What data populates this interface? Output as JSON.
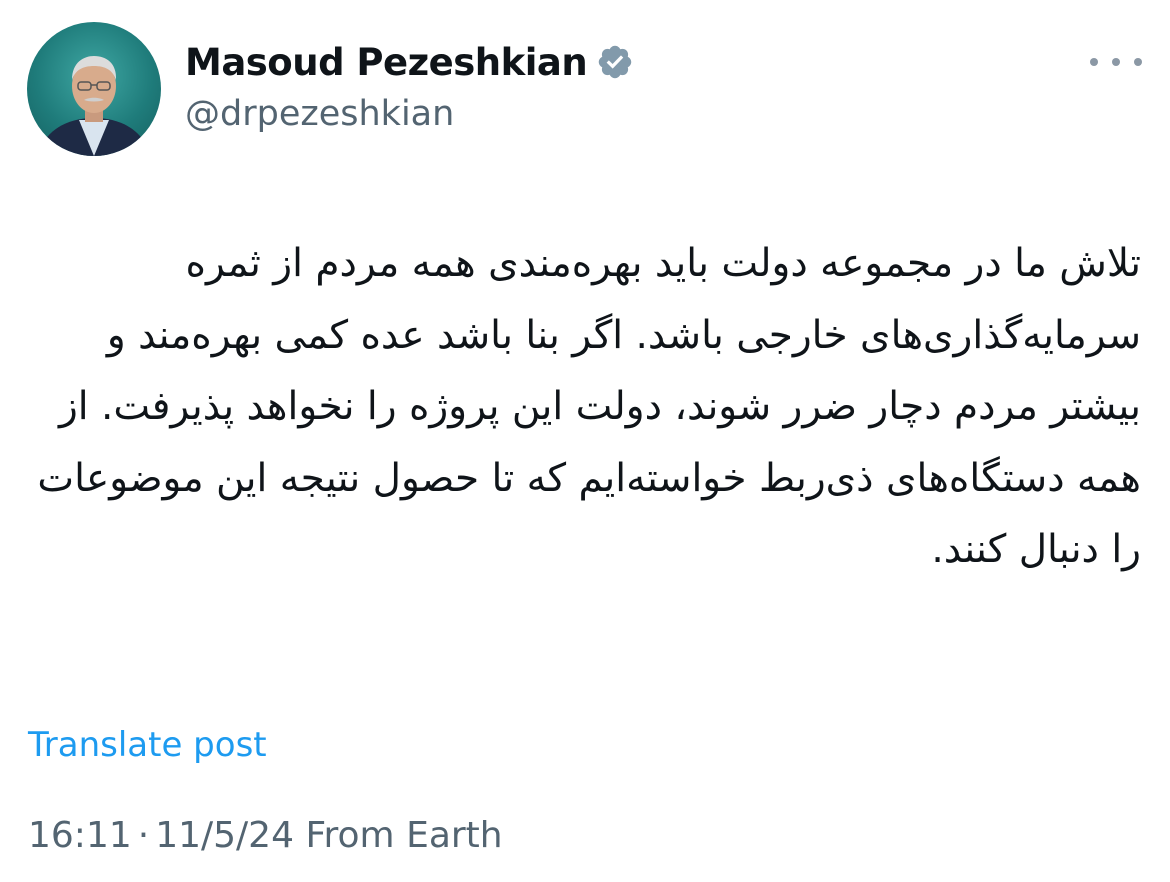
{
  "author": {
    "display_name": "Masoud Pezeshkian",
    "handle": "@drpezeshkian",
    "verified": true,
    "avatar_icon": "user-avatar"
  },
  "post": {
    "text": "تلاش ما در مجموعه دولت باید بهره‌مندی همه مردم از ثمره سرمایه‌گذاری‌های خارجی باشد. اگر بنا باشد عده کمی بهره‌مند و بیشتر مردم دچار ضرر شوند، دولت این پروژه را نخواهد پذیرفت. از همه دستگاه‌های ذی‌ربط خواسته‌ایم که تا حصول نتیجه این موضوعات را دنبال کنند.",
    "translate_label": "Translate post"
  },
  "meta": {
    "time": "16:11",
    "separator": "·",
    "date": "11/5/24",
    "source": "From Earth"
  },
  "colors": {
    "text_primary": "#0f1419",
    "text_secondary": "#536471",
    "link": "#1d9bf0",
    "badge": "#829aab"
  }
}
